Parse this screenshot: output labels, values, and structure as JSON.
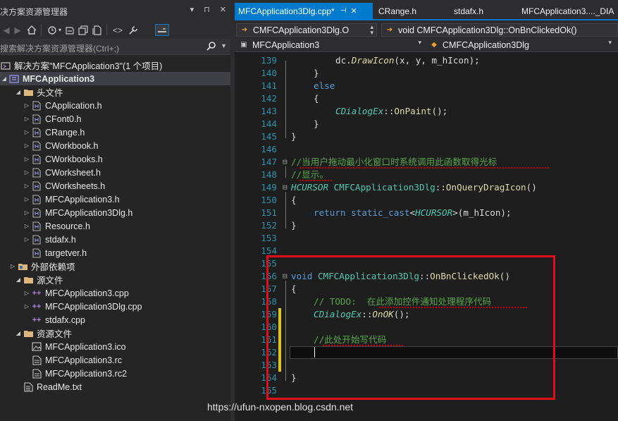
{
  "solution_explorer": {
    "title": "决方案资源管理器",
    "title_icons": [
      "▾",
      "⊓",
      "✕"
    ],
    "search_placeholder": "搜索解决方案资源管理器(Ctrl+;)",
    "tree": [
      {
        "label": "解决方案\"MFCApplication3\"(1 个项目)",
        "icon": "solution-icon"
      },
      {
        "label": "MFCApplication3",
        "icon": "project-icon"
      },
      {
        "label": "头文件",
        "icon": "folder-icon"
      },
      {
        "label": "CApplication.h",
        "icon": "header-file-icon"
      },
      {
        "label": "CFont0.h",
        "icon": "header-file-icon"
      },
      {
        "label": "CRange.h",
        "icon": "header-file-icon"
      },
      {
        "label": "CWorkbook.h",
        "icon": "header-file-icon"
      },
      {
        "label": "CWorkbooks.h",
        "icon": "header-file-icon"
      },
      {
        "label": "CWorksheet.h",
        "icon": "header-file-icon"
      },
      {
        "label": "CWorksheets.h",
        "icon": "header-file-icon"
      },
      {
        "label": "MFCApplication3.h",
        "icon": "header-file-icon"
      },
      {
        "label": "MFCApplication3Dlg.h",
        "icon": "header-file-icon"
      },
      {
        "label": "Resource.h",
        "icon": "header-file-icon"
      },
      {
        "label": "stdafx.h",
        "icon": "header-file-icon"
      },
      {
        "label": "targetver.h",
        "icon": "header-file-icon"
      },
      {
        "label": "外部依赖项",
        "icon": "external-deps-icon"
      },
      {
        "label": "源文件",
        "icon": "folder-icon"
      },
      {
        "label": "MFCApplication3.cpp",
        "icon": "cpp-file-icon"
      },
      {
        "label": "MFCApplication3Dlg.cpp",
        "icon": "cpp-file-icon"
      },
      {
        "label": "stdafx.cpp",
        "icon": "cpp-file-icon"
      },
      {
        "label": "资源文件",
        "icon": "folder-icon"
      },
      {
        "label": "MFCApplication3.ico",
        "icon": "image-file-icon"
      },
      {
        "label": "MFCApplication3.rc",
        "icon": "resource-file-icon"
      },
      {
        "label": "MFCApplication3.rc2",
        "icon": "resource-file-icon"
      },
      {
        "label": "ReadMe.txt",
        "icon": "text-file-icon"
      }
    ]
  },
  "editor": {
    "tabs": [
      {
        "label": "MFCApplication3Dlg.cpp*",
        "active": true
      },
      {
        "label": "CRange.h",
        "active": false
      },
      {
        "label": "stdafx.h",
        "active": false
      },
      {
        "label": "MFCApplication3...._DIA",
        "active": false
      }
    ],
    "nav_left": "CMFCApplication3Dlg.O",
    "nav_right": "void CMFCApplication3Dlg::OnBnClickedOk()",
    "nav_project": "MFCApplication3",
    "nav_class": "CMFCApplication3Dlg",
    "line_numbers": [
      "139",
      "140",
      "141",
      "142",
      "143",
      "144",
      "145",
      "146",
      "147",
      "148",
      "149",
      "150",
      "151",
      "152",
      "153",
      "154",
      "155",
      "156",
      "157",
      "158",
      "159",
      "160",
      "161",
      "162",
      "163",
      "164",
      "165"
    ],
    "code": {
      "l139": "dc.DrawIcon(x, y, m_hIcon);",
      "l140": "}",
      "l141": "else",
      "l142": "{",
      "l143": "CDialogEx::OnPaint();",
      "l144": "}",
      "l145": "}",
      "l147": "//当用户拖动最小化窗口时系统调用此函数取得光标",
      "l148": "//显示。",
      "l149": "HCURSOR CMFCApplication3Dlg::OnQueryDragIcon()",
      "l150": "{",
      "l151": "return static_cast<HCURSOR>(m_hIcon);",
      "l152": "}",
      "l156": "void CMFCApplication3Dlg::OnBnClickedOk()",
      "l157": "{",
      "l158": "// TODO:  在此添加控件通知处理程序代码",
      "l159": "CDialogEx::OnOK();",
      "l161": "//此处开始写代码",
      "l164": "}"
    }
  },
  "watermark": "https://ufun-nxopen.blog.csdn.net",
  "colors": {
    "accent": "#007acc",
    "highlight_box": "#e0101a",
    "change_marker": "#e2c50a"
  }
}
